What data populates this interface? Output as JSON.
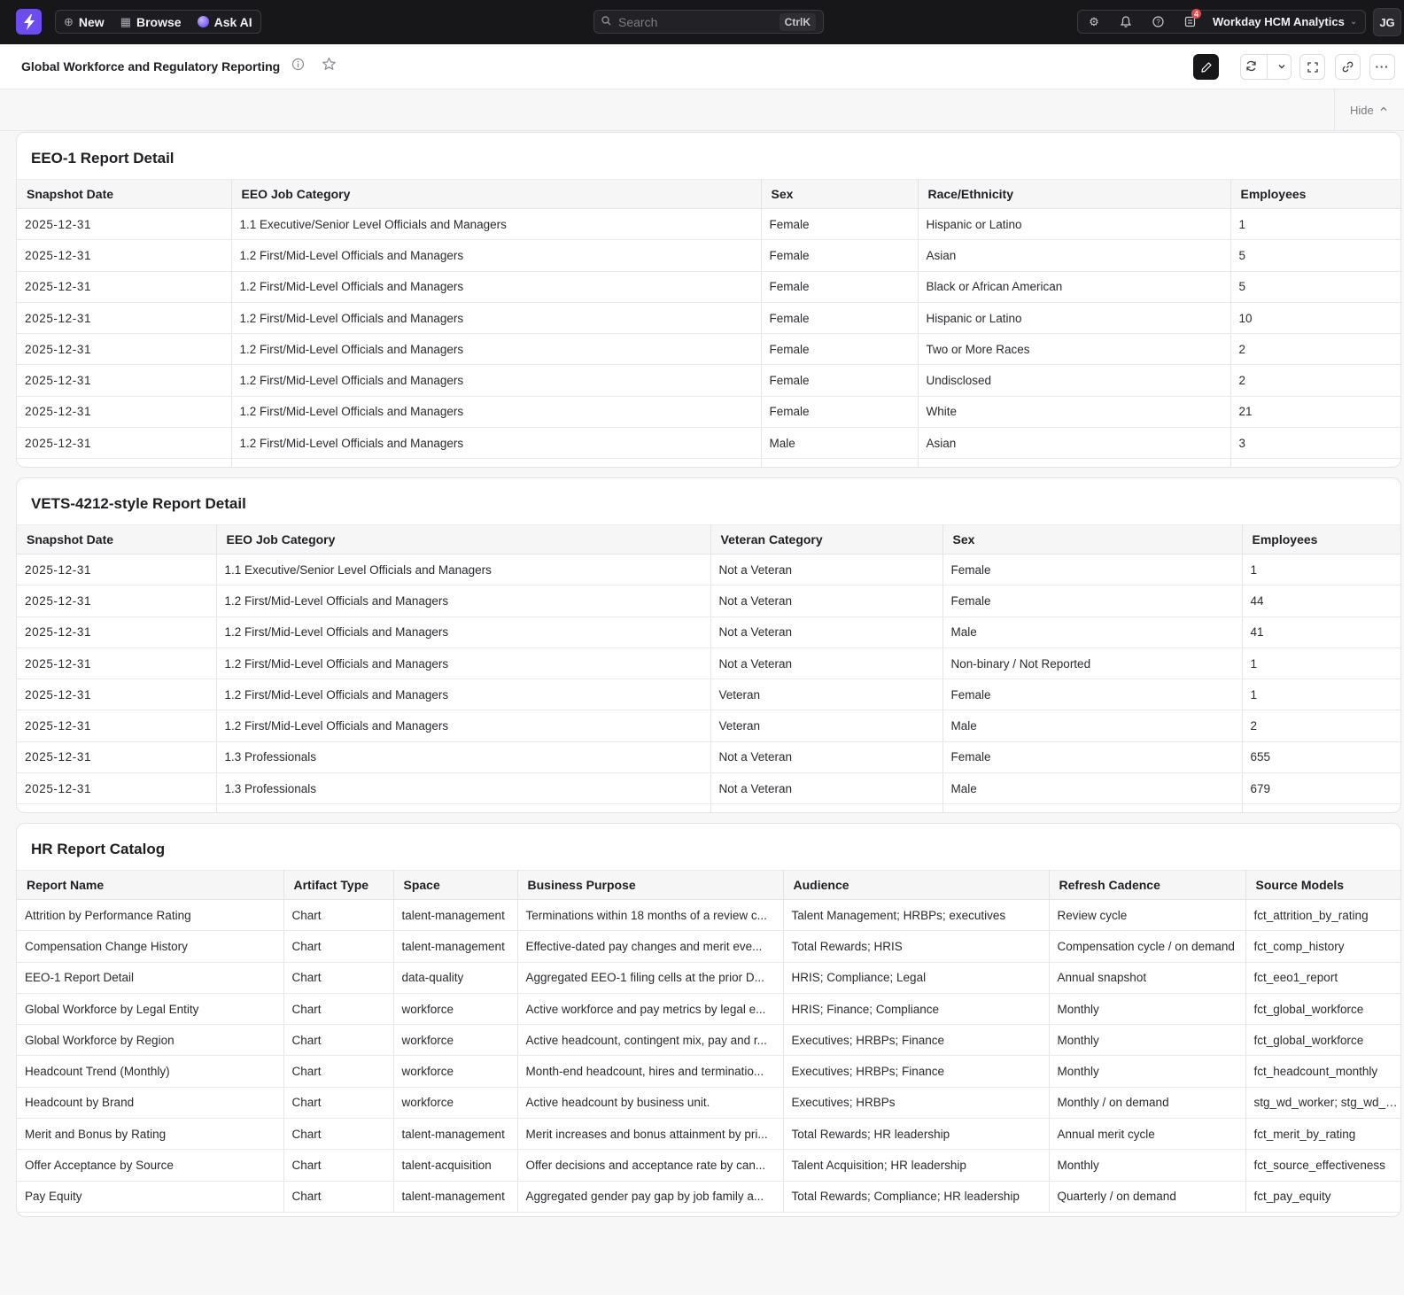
{
  "topbar": {
    "new_label": "New",
    "browse_label": "Browse",
    "ask_ai_label": "Ask AI",
    "search_placeholder": "Search",
    "search_shortcut": "CtrlK",
    "notification_count": "4",
    "workspace_name": "Workday HCM Analytics",
    "user_initials": "JG"
  },
  "page": {
    "title": "Global Workforce and Regulatory Reporting",
    "hide_label": "Hide"
  },
  "eeo1": {
    "title": "EEO-1 Report Detail",
    "columns": [
      "Snapshot Date",
      "EEO Job Category",
      "Sex",
      "Race/Ethnicity",
      "Employees"
    ],
    "rows": [
      [
        "2025-12-31",
        "1.1 Executive/Senior Level Officials and Managers",
        "Female",
        "Hispanic or Latino",
        "1"
      ],
      [
        "2025-12-31",
        "1.2 First/Mid-Level Officials and Managers",
        "Female",
        "Asian",
        "5"
      ],
      [
        "2025-12-31",
        "1.2 First/Mid-Level Officials and Managers",
        "Female",
        "Black or African American",
        "5"
      ],
      [
        "2025-12-31",
        "1.2 First/Mid-Level Officials and Managers",
        "Female",
        "Hispanic or Latino",
        "10"
      ],
      [
        "2025-12-31",
        "1.2 First/Mid-Level Officials and Managers",
        "Female",
        "Two or More Races",
        "2"
      ],
      [
        "2025-12-31",
        "1.2 First/Mid-Level Officials and Managers",
        "Female",
        "Undisclosed",
        "2"
      ],
      [
        "2025-12-31",
        "1.2 First/Mid-Level Officials and Managers",
        "Female",
        "White",
        "21"
      ],
      [
        "2025-12-31",
        "1.2 First/Mid-Level Officials and Managers",
        "Male",
        "Asian",
        "3"
      ]
    ]
  },
  "vets": {
    "title": "VETS-4212-style Report Detail",
    "columns": [
      "Snapshot Date",
      "EEO Job Category",
      "Veteran Category",
      "Sex",
      "Employees"
    ],
    "rows": [
      [
        "2025-12-31",
        "1.1 Executive/Senior Level Officials and Managers",
        "Not a Veteran",
        "Female",
        "1"
      ],
      [
        "2025-12-31",
        "1.2 First/Mid-Level Officials and Managers",
        "Not a Veteran",
        "Female",
        "44"
      ],
      [
        "2025-12-31",
        "1.2 First/Mid-Level Officials and Managers",
        "Not a Veteran",
        "Male",
        "41"
      ],
      [
        "2025-12-31",
        "1.2 First/Mid-Level Officials and Managers",
        "Not a Veteran",
        "Non-binary / Not Reported",
        "1"
      ],
      [
        "2025-12-31",
        "1.2 First/Mid-Level Officials and Managers",
        "Veteran",
        "Female",
        "1"
      ],
      [
        "2025-12-31",
        "1.2 First/Mid-Level Officials and Managers",
        "Veteran",
        "Male",
        "2"
      ],
      [
        "2025-12-31",
        "1.3 Professionals",
        "Not a Veteran",
        "Female",
        "655"
      ],
      [
        "2025-12-31",
        "1.3 Professionals",
        "Not a Veteran",
        "Male",
        "679"
      ]
    ]
  },
  "catalog": {
    "title": "HR Report Catalog",
    "columns": [
      "Report Name",
      "Artifact Type",
      "Space",
      "Business Purpose",
      "Audience",
      "Refresh Cadence",
      "Source Models"
    ],
    "rows": [
      [
        "Attrition by Performance Rating",
        "Chart",
        "talent-management",
        "Terminations within 18 months of a review c...",
        "Talent Management; HRBPs; executives",
        "Review cycle",
        "fct_attrition_by_rating"
      ],
      [
        "Compensation Change History",
        "Chart",
        "talent-management",
        "Effective-dated pay changes and merit eve...",
        "Total Rewards; HRIS",
        "Compensation cycle / on demand",
        "fct_comp_history"
      ],
      [
        "EEO-1 Report Detail",
        "Chart",
        "data-quality",
        "Aggregated EEO-1 filing cells at the prior D...",
        "HRIS; Compliance; Legal",
        "Annual snapshot",
        "fct_eeo1_report"
      ],
      [
        "Global Workforce by Legal Entity",
        "Chart",
        "workforce",
        "Active workforce and pay metrics by legal e...",
        "HRIS; Finance; Compliance",
        "Monthly",
        "fct_global_workforce"
      ],
      [
        "Global Workforce by Region",
        "Chart",
        "workforce",
        "Active headcount, contingent mix, pay and r...",
        "Executives; HRBPs; Finance",
        "Monthly",
        "fct_global_workforce"
      ],
      [
        "Headcount Trend (Monthly)",
        "Chart",
        "workforce",
        "Month-end headcount, hires and terminatio...",
        "Executives; HRBPs; Finance",
        "Monthly",
        "fct_headcount_monthly"
      ],
      [
        "Headcount by Brand",
        "Chart",
        "workforce",
        "Active headcount by business unit.",
        "Executives; HRBPs",
        "Monthly / on demand",
        "stg_wd_worker; stg_wd_sup"
      ],
      [
        "Merit and Bonus by Rating",
        "Chart",
        "talent-management",
        "Merit increases and bonus attainment by pri...",
        "Total Rewards; HR leadership",
        "Annual merit cycle",
        "fct_merit_by_rating"
      ],
      [
        "Offer Acceptance by Source",
        "Chart",
        "talent-acquisition",
        "Offer decisions and acceptance rate by can...",
        "Talent Acquisition; HR leadership",
        "Monthly",
        "fct_source_effectiveness"
      ],
      [
        "Pay Equity",
        "Chart",
        "talent-management",
        "Aggregated gender pay gap by job family a...",
        "Total Rewards; Compliance; HR leadership",
        "Quarterly / on demand",
        "fct_pay_equity"
      ]
    ]
  },
  "colors": {
    "brand": "#6d4df2",
    "topbar_bg": "#17171a",
    "badge": "#e5484d"
  }
}
